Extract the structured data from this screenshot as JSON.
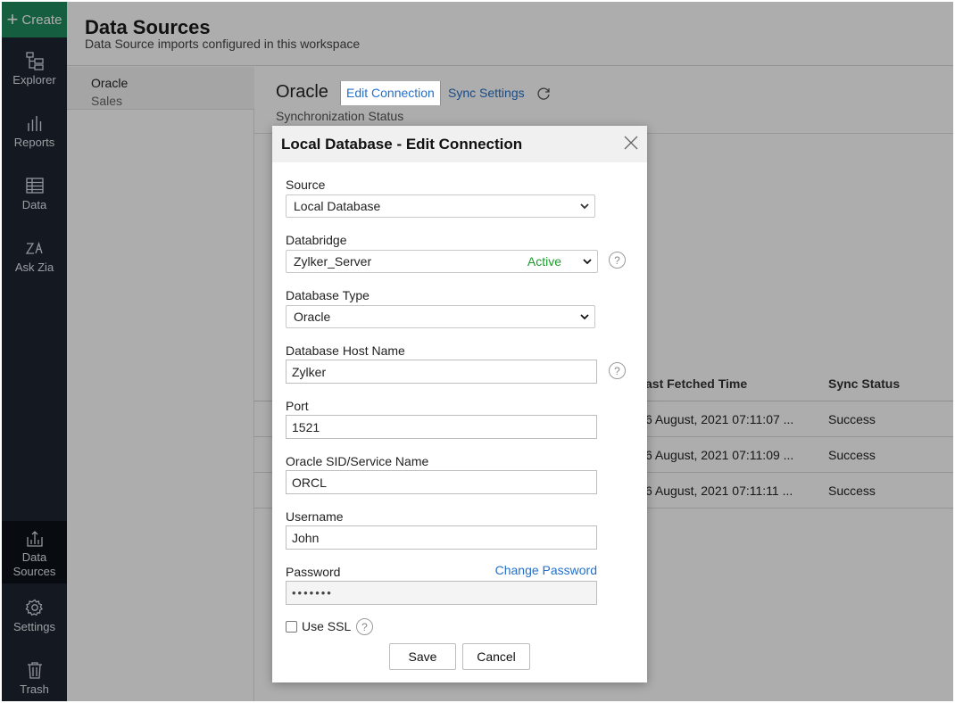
{
  "sidebar": {
    "create_label": "Create",
    "items": [
      {
        "label": "Explorer",
        "icon": "explorer-icon"
      },
      {
        "label": "Reports",
        "icon": "reports-icon"
      },
      {
        "label": "Data",
        "icon": "data-table-icon"
      },
      {
        "label": "Ask Zia",
        "icon": "ask-zia-icon"
      },
      {
        "label_line1": "Data",
        "label_line2": "Sources",
        "icon": "data-sources-icon"
      },
      {
        "label": "Settings",
        "icon": "gear-icon"
      },
      {
        "label": "Trash",
        "icon": "trash-icon"
      }
    ]
  },
  "header": {
    "title": "Data Sources",
    "subtitle": "Data Source imports configured in this workspace"
  },
  "left_panel": {
    "item_name": "Oracle",
    "item_workspace": "Sales"
  },
  "right_panel": {
    "title": "Oracle",
    "tab_edit": "Edit Connection",
    "tab_sync": "Sync Settings",
    "sync_status_label": "Synchronization Status",
    "table_headers": {
      "fetched": "ast Fetched Time",
      "status": "Sync Status"
    },
    "rows": [
      {
        "fetched": "6 August, 2021 07:11:07 ...",
        "status": "Success"
      },
      {
        "fetched": "6 August, 2021 07:11:09 ...",
        "status": "Success"
      },
      {
        "fetched": "6 August, 2021 07:11:11 ...",
        "status": "Success"
      }
    ]
  },
  "modal": {
    "title": "Local Database - Edit Connection",
    "source_label": "Source",
    "source_value": "Local Database",
    "databridge_label": "Databridge",
    "databridge_value": "Zylker_Server",
    "databridge_status": "Active",
    "dbtype_label": "Database Type",
    "dbtype_value": "Oracle",
    "host_label": "Database Host Name",
    "host_value": "Zylker",
    "port_label": "Port",
    "port_value": "1521",
    "sid_label": "Oracle SID/Service Name",
    "sid_value": "ORCL",
    "username_label": "Username",
    "username_value": "John",
    "password_label": "Password",
    "password_value": "•••••••",
    "change_password": "Change Password",
    "ssl_label": "Use SSL",
    "help_glyph": "?",
    "save": "Save",
    "cancel": "Cancel"
  },
  "colors": {
    "sidebar_bg": "#1c2431",
    "create_green": "#1f8b5e",
    "link_blue": "#2470c9",
    "active_green": "#1c9a2c"
  }
}
